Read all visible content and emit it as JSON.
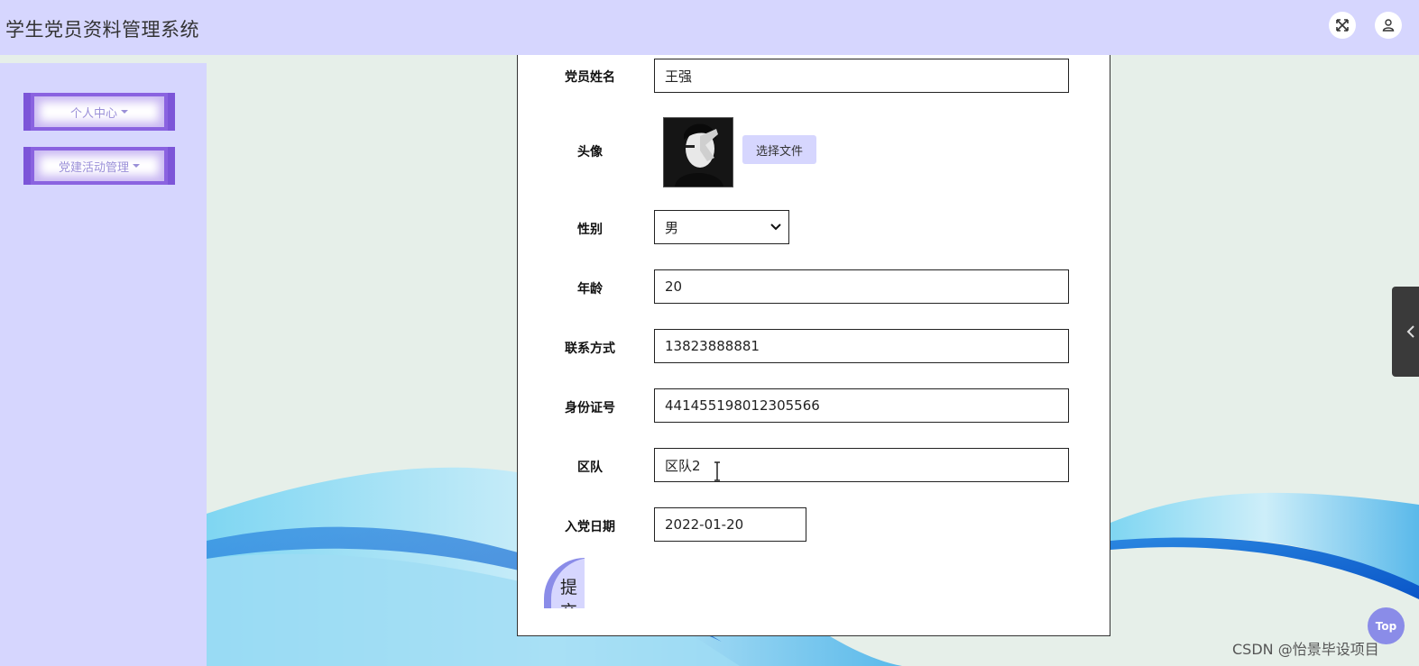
{
  "header": {
    "title": "学生党员资料管理系统",
    "fullscreen_icon": "expand-arrows-icon",
    "user_icon": "user-icon",
    "color": "#d6d6fe"
  },
  "sidebar": {
    "items": [
      {
        "label": "个人中心"
      },
      {
        "label": "党建活动管理"
      }
    ]
  },
  "form": {
    "fields": {
      "name": {
        "label": "党员姓名",
        "value": "王强"
      },
      "avatar": {
        "label": "头像",
        "button": "选择文件"
      },
      "gender": {
        "label": "性别",
        "value": "男"
      },
      "age": {
        "label": "年龄",
        "value": "20"
      },
      "phone": {
        "label": "联系方式",
        "value": "13823888881"
      },
      "id_number": {
        "label": "身份证号",
        "value": "441455198012305566"
      },
      "district": {
        "label": "区队",
        "value": "区队2"
      },
      "join_date": {
        "label": "入党日期",
        "value": "2022-01-20"
      }
    },
    "submit_label": "提交"
  },
  "top_button": "Top",
  "watermark": "CSDN @怡景毕设项目",
  "colors": {
    "accent": "#8a8ce8",
    "menu_border": "#7c55d8",
    "background": "#e6efe9"
  }
}
